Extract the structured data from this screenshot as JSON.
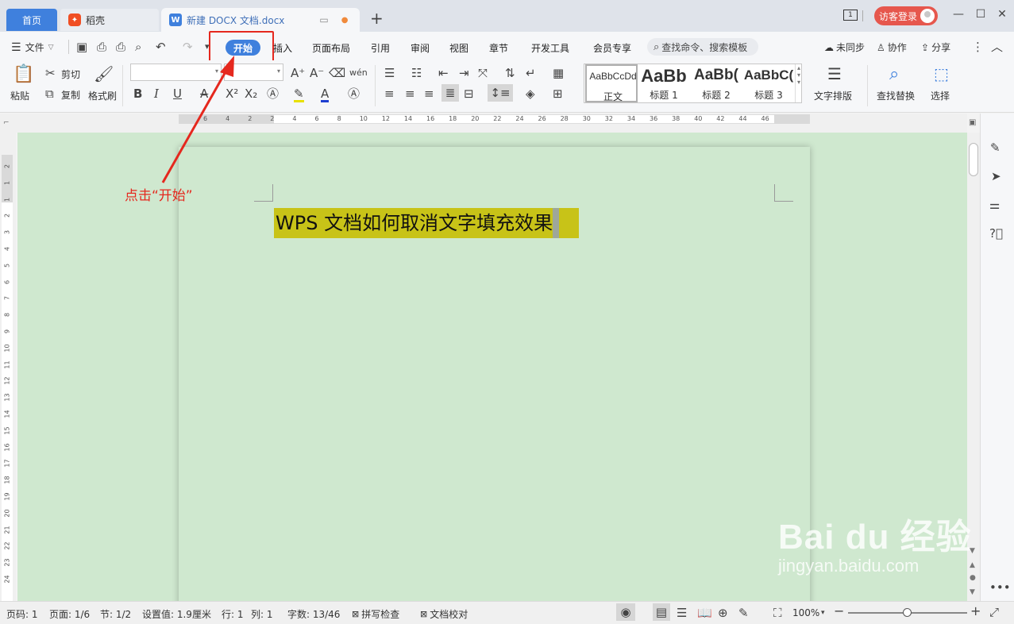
{
  "tabs": {
    "home": "首页",
    "shell": "稻壳",
    "doc": "新建 DOCX 文档.docx"
  },
  "titlebar": {
    "guest_login": "访客登录",
    "page_count_badge": "1"
  },
  "menu": {
    "file": "文件",
    "start": "开始",
    "insert": "插入",
    "layout": "页面布局",
    "reference": "引用",
    "review": "审阅",
    "view": "视图",
    "chapter": "章节",
    "devtools": "开发工具",
    "member": "会员专享",
    "search_placeholder": "查找命令、搜索模板",
    "unsynced": "未同步",
    "collab": "协作",
    "share": "分享"
  },
  "ribbon": {
    "paste": "粘贴",
    "cut": "剪切",
    "copy": "复制",
    "format_painter": "格式刷",
    "text_layout": "文字排版",
    "find_replace": "查找替换",
    "select": "选择",
    "styles": [
      {
        "sample": "AaBbCcDd",
        "name": "正文"
      },
      {
        "sample": "AaBb",
        "name": "标题 1"
      },
      {
        "sample": "AaBb(",
        "name": "标题 2"
      },
      {
        "sample": "AaBbC(",
        "name": "标题 3"
      }
    ]
  },
  "ruler": {
    "h_ticks": [
      "6",
      "4",
      "2",
      "2",
      "4",
      "6",
      "8",
      "10",
      "12",
      "14",
      "16",
      "18",
      "20",
      "22",
      "24",
      "26",
      "28",
      "30",
      "32",
      "34",
      "36",
      "38",
      "40",
      "42",
      "44",
      "46"
    ],
    "v_ticks": [
      "2",
      "1",
      "1",
      "2",
      "3",
      "4",
      "5",
      "6",
      "7",
      "8",
      "9",
      "10",
      "11",
      "12",
      "13",
      "14",
      "15",
      "16",
      "17",
      "18",
      "19",
      "20",
      "21",
      "22",
      "23",
      "24"
    ]
  },
  "document": {
    "text": "WPS 文档如何取消文字填充效果"
  },
  "annotation": {
    "text": "点击“开始”",
    "color": "#e5281e"
  },
  "status": {
    "page_no": "页码: 1",
    "pages": "页面: 1/6",
    "section": "节: 1/2",
    "setting": "设置值: 1.9厘米",
    "row": "行: 1",
    "col": "列: 1",
    "words": "字数: 13/46",
    "spell": "拼写检查",
    "proof": "文档校对",
    "zoom": "100%"
  },
  "watermark": {
    "brand": "Bai du 经验",
    "url": "jingyan.baidu.com"
  },
  "colors": {
    "accent": "#3f80dd",
    "page_bg": "#cfe8cf",
    "highlight": "#c8c318"
  }
}
